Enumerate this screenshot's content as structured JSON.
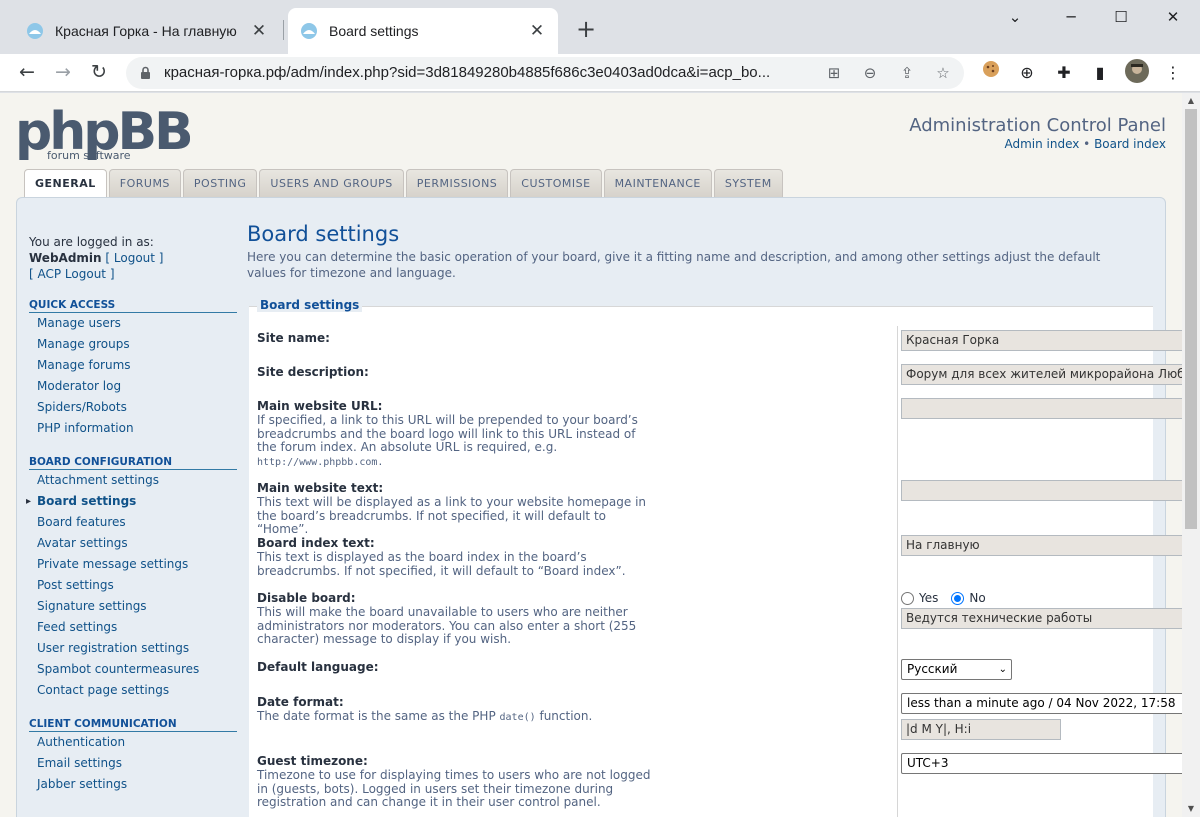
{
  "browser": {
    "tabs": [
      {
        "title": "Красная Горка - На главную",
        "active": false
      },
      {
        "title": "Board settings",
        "active": true
      }
    ],
    "new_tab": "+",
    "url": "красная-горка.рф/adm/index.php?sid=3d81849280b4885f686c3e0403ad0dca&i=acp_bo..."
  },
  "header": {
    "logo_main": "phpBB",
    "logo_sub": "forum software",
    "acp_title": "Administration Control Panel",
    "link_admin_index": "Admin index",
    "separator": "•",
    "link_board_index": "Board index"
  },
  "tabs": [
    "GENERAL",
    "FORUMS",
    "POSTING",
    "USERS AND GROUPS",
    "PERMISSIONS",
    "CUSTOMISE",
    "MAINTENANCE",
    "SYSTEM"
  ],
  "sidebar": {
    "logged_in_as": "You are logged in as:",
    "username": "WebAdmin",
    "logout": "[ Logout ]",
    "acp_logout": "[ ACP Logout ]",
    "sections": [
      {
        "title": "QUICK ACCESS",
        "items": [
          "Manage users",
          "Manage groups",
          "Manage forums",
          "Moderator log",
          "Spiders/Robots",
          "PHP information"
        ]
      },
      {
        "title": "BOARD CONFIGURATION",
        "items": [
          "Attachment settings",
          "Board settings",
          "Board features",
          "Avatar settings",
          "Private message settings",
          "Post settings",
          "Signature settings",
          "Feed settings",
          "User registration settings",
          "Spambot countermeasures",
          "Contact page settings"
        ]
      },
      {
        "title": "CLIENT COMMUNICATION",
        "items": [
          "Authentication",
          "Email settings",
          "Jabber settings"
        ]
      }
    ]
  },
  "main": {
    "title": "Board settings",
    "intro": "Here you can determine the basic operation of your board, give it a fitting name and description, and among other settings adjust the default values for timezone and language.",
    "legend": "Board settings",
    "fields": {
      "site_name": {
        "label": "Site name:",
        "value": "Красная Горка"
      },
      "site_desc": {
        "label": "Site description:",
        "value": "Форум для всех жителей микрорайона Люберец"
      },
      "main_url": {
        "label": "Main website URL:",
        "explain": "If specified, a link to this URL will be prepended to your board’s breadcrumbs and the board logo will link to this URL instead of the forum index. An absolute URL is required, e.g.",
        "example": "http://www.phpbb.com.",
        "value": ""
      },
      "main_text": {
        "label": "Main website text:",
        "explain": "This text will be displayed as a link to your website homepage in the board’s breadcrumbs. If not specified, it will default to “Home”.",
        "value": ""
      },
      "index_text": {
        "label": "Board index text:",
        "explain": "This text is displayed as the board index in the board’s breadcrumbs. If not specified, it will default to “Board index”.",
        "value": "На главную"
      },
      "disable": {
        "label": "Disable board:",
        "explain": "This will make the board unavailable to users who are neither administrators nor moderators. You can also enter a short (255 character) message to display if you wish.",
        "yes": "Yes",
        "no": "No",
        "selected": "No",
        "message": "Ведутся технические работы"
      },
      "language": {
        "label": "Default language:",
        "value": "Русский"
      },
      "date_format": {
        "label": "Date format:",
        "explain_pre": "The date format is the same as the PHP",
        "explain_code": "date()",
        "explain_post": "function.",
        "value": "less than a minute ago / 04 Nov 2022, 17:58",
        "custom": "|d M Y|, H:i"
      },
      "timezone": {
        "label": "Guest timezone:",
        "explain": "Timezone to use for displaying times to users who are not logged in (guests, bots). Logged in users set their timezone during registration and can change it in their user control panel.",
        "value": "UTC+3"
      }
    }
  }
}
